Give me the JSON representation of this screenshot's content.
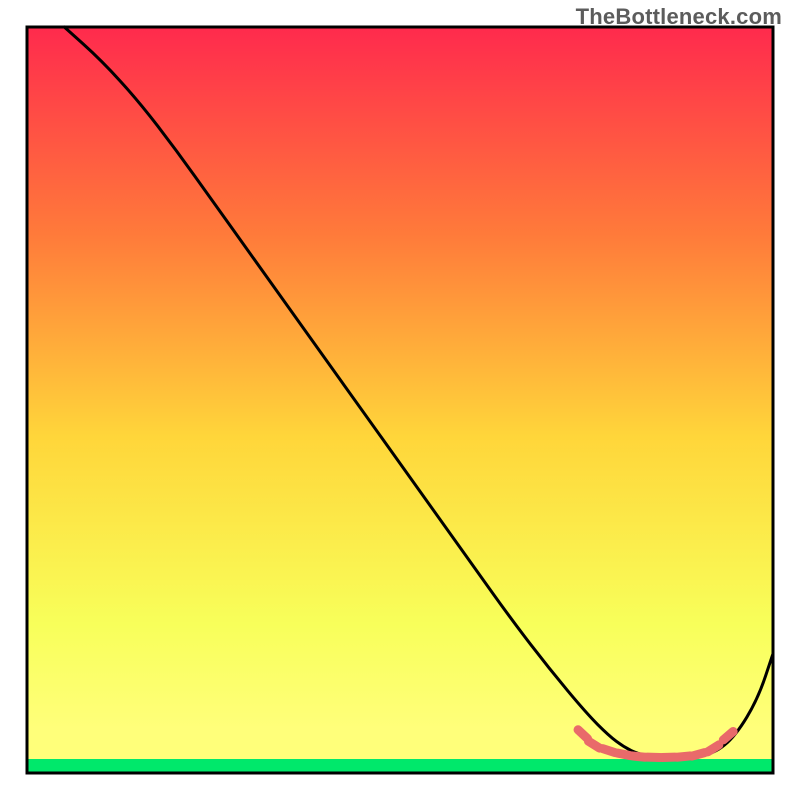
{
  "watermark": "TheBottleneck.com",
  "chart_data": {
    "type": "line",
    "title": "",
    "xlabel": "",
    "ylabel": "",
    "xlim": [
      0,
      100
    ],
    "ylim": [
      0,
      100
    ],
    "gradient_colors": {
      "top": "#ff2a4d",
      "upper_mid": "#ff7b3a",
      "mid": "#ffd63a",
      "lower_mid": "#f8ff5a",
      "bottom_band": "#ffff7a",
      "green_band": "#00e86b"
    },
    "series": [
      {
        "name": "curve",
        "color": "#000000",
        "x": [
          5,
          10,
          15,
          20,
          25,
          30,
          35,
          40,
          45,
          50,
          55,
          60,
          65,
          70,
          75,
          78,
          80,
          82,
          85,
          88,
          92,
          95,
          98,
          100
        ],
        "y": [
          100,
          95.5,
          90,
          83.5,
          76.5,
          69.5,
          62.5,
          55.5,
          48.5,
          41.5,
          34.5,
          27.5,
          20.5,
          14,
          8,
          5,
          3.5,
          2.5,
          2,
          2,
          2.5,
          5,
          10,
          16
        ]
      },
      {
        "name": "highlight",
        "color": "#e96a6a",
        "x": [
          74.5,
          76,
          78,
          80,
          82,
          84,
          86,
          88,
          90,
          92,
          94
        ],
        "y": [
          5.2,
          3.8,
          3.0,
          2.5,
          2.2,
          2.1,
          2.1,
          2.2,
          2.5,
          3.3,
          5.0
        ]
      }
    ]
  }
}
